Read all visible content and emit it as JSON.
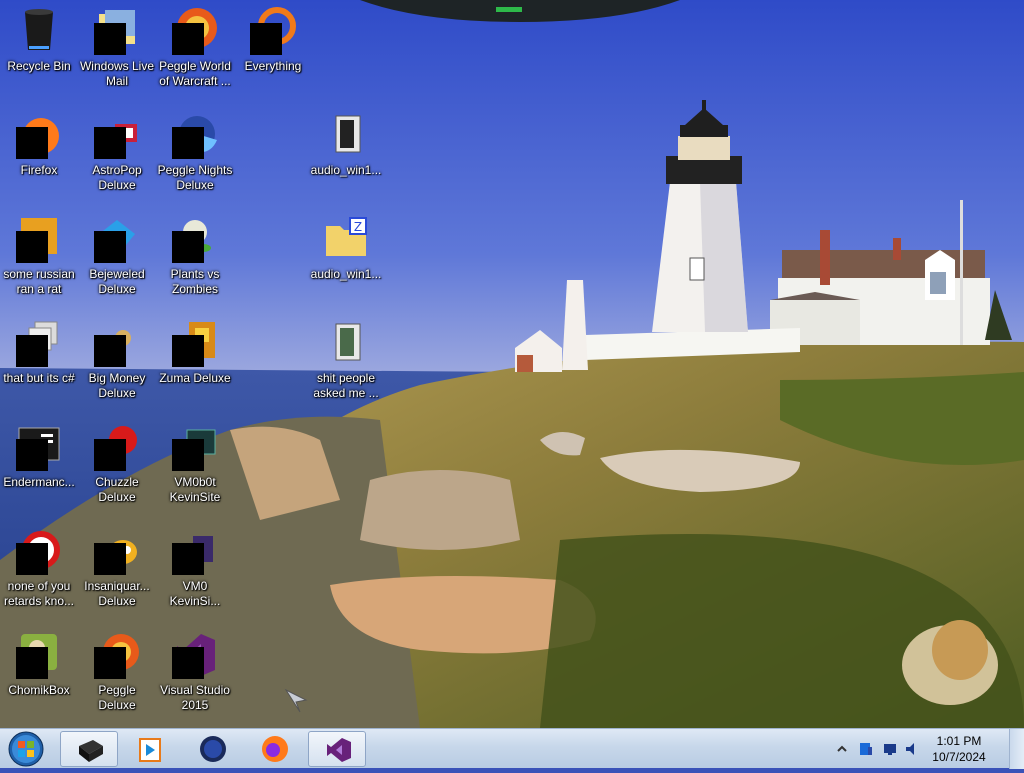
{
  "desktop": {
    "icons": [
      {
        "label": "Recycle Bin",
        "icon": "recycle-bin-icon",
        "censored": false
      },
      {
        "label": "Windows Live Mail",
        "icon": "mail-icon",
        "censored": true
      },
      {
        "label": "Peggle World of Warcraft ...",
        "icon": "peggle-icon",
        "censored": true
      },
      {
        "label": "Everything",
        "icon": "search-app-icon",
        "censored": true
      },
      {
        "label": "Firefox",
        "icon": "firefox-icon",
        "censored": true
      },
      {
        "label": "AstroPop Deluxe",
        "icon": "game-icon",
        "censored": true
      },
      {
        "label": "Peggle Nights Deluxe",
        "icon": "peggle-icon",
        "censored": true
      },
      {
        "label": "audio_win1...",
        "icon": "folder-icon",
        "censored": false
      },
      {
        "label": "some russian ran a rat",
        "icon": "app-icon",
        "censored": true
      },
      {
        "label": "Bejeweled Deluxe",
        "icon": "gem-icon",
        "censored": true
      },
      {
        "label": "Plants vs Zombies",
        "icon": "plant-icon",
        "censored": true
      },
      {
        "label": "audio_win1...",
        "icon": "zip-folder-icon",
        "censored": false
      },
      {
        "label": "that but its c#",
        "icon": "stack-icon",
        "censored": true
      },
      {
        "label": "Big Money Deluxe",
        "icon": "money-bag-icon",
        "censored": true
      },
      {
        "label": "Zuma Deluxe",
        "icon": "zuma-icon",
        "censored": true
      },
      {
        "label": "shit people asked me ...",
        "icon": "folder-icon",
        "censored": false
      },
      {
        "label": "Endermanc...",
        "icon": "terminal-icon",
        "censored": true
      },
      {
        "label": "Chuzzle Deluxe",
        "icon": "chuzzle-icon",
        "censored": true
      },
      {
        "label": "VM0b0t KevinSite",
        "icon": "vm-icon",
        "censored": true
      },
      {
        "label": "none of you retards kno...",
        "icon": "opera-icon",
        "censored": true
      },
      {
        "label": "Insaniquar... Deluxe",
        "icon": "fish-icon",
        "censored": true
      },
      {
        "label": "VM0 KevinSi...",
        "icon": "vm-icon",
        "censored": true
      },
      {
        "label": "ChomikBox",
        "icon": "chomik-icon",
        "censored": true
      },
      {
        "label": "Peggle Deluxe",
        "icon": "peggle-icon",
        "censored": true
      },
      {
        "label": "Visual Studio 2015",
        "icon": "visual-studio-icon",
        "censored": true
      }
    ]
  },
  "taskbar": {
    "buttons": [
      {
        "name": "start-button",
        "icon": "windows-orb-icon"
      },
      {
        "name": "pinned-app",
        "icon": "black-box-icon",
        "active": true
      },
      {
        "name": "media-player",
        "icon": "media-player-icon"
      },
      {
        "name": "globe-app",
        "icon": "globe-icon"
      },
      {
        "name": "firefox",
        "icon": "firefox-icon"
      },
      {
        "name": "visual-studio",
        "icon": "visual-studio-icon",
        "active": true
      }
    ],
    "tray": {
      "time": "1:01 PM",
      "date": "10/7/2024"
    }
  },
  "colors": {
    "taskbar": "#c7d7ea",
    "label_text": "#ffffff"
  }
}
